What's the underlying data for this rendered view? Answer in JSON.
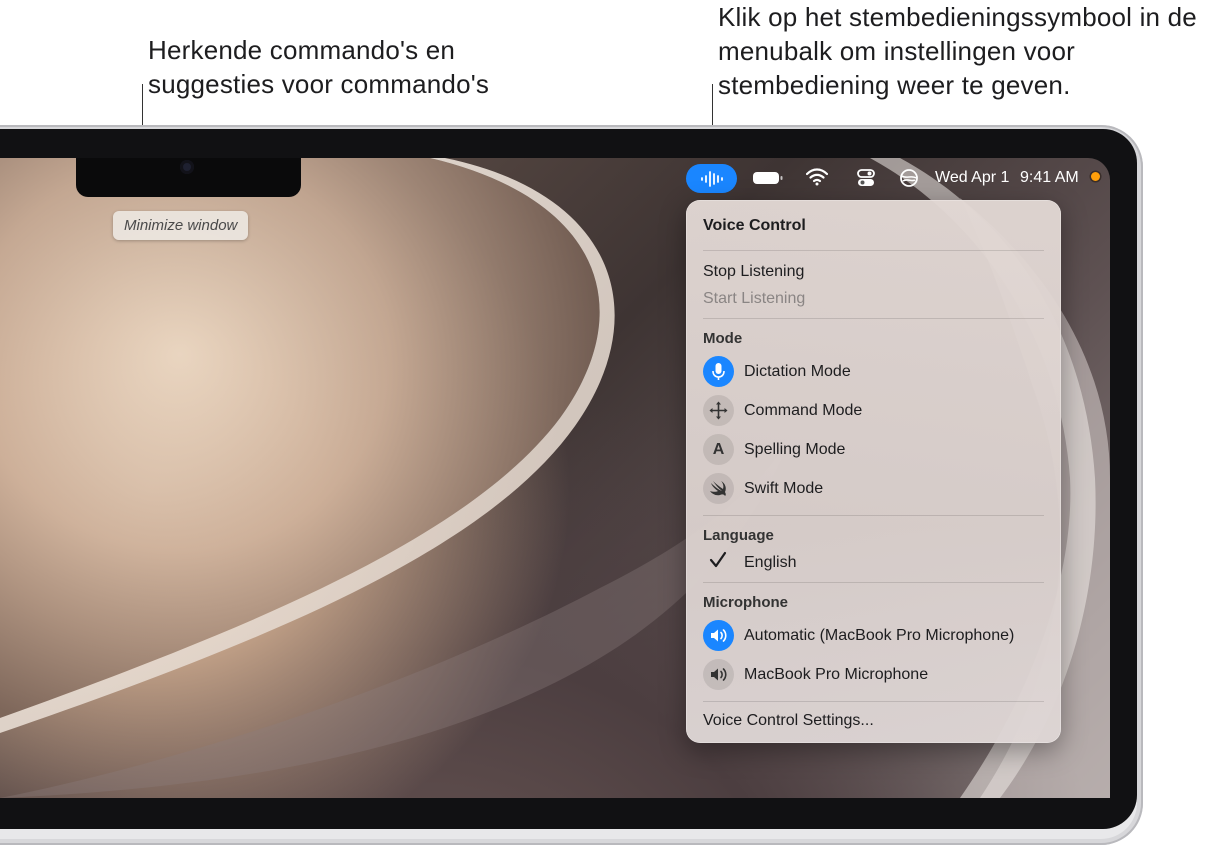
{
  "callouts": {
    "left": "Herkende commando's en suggesties voor commando's",
    "right": "Klik op het stembedieningssymbool in de menubalk om instellingen voor stembediening weer te geven."
  },
  "suggestion": {
    "text": "Minimize window"
  },
  "menubar": {
    "date": "Wed Apr 1",
    "time": "9:41 AM",
    "accent_color": "#1a86ff",
    "icons": [
      "voice-control-icon",
      "battery-icon",
      "wifi-icon",
      "control-center-icon",
      "vpn-icon"
    ]
  },
  "menu": {
    "title": "Voice Control",
    "stop_listening": "Stop Listening",
    "start_listening": "Start Listening",
    "mode_header": "Mode",
    "modes": [
      {
        "label": "Dictation Mode",
        "selected": true,
        "icon": "microphone-icon"
      },
      {
        "label": "Command Mode",
        "selected": false,
        "icon": "move-arrows-icon"
      },
      {
        "label": "Spelling Mode",
        "selected": false,
        "icon": "letter-a-icon",
        "glyph": "A"
      },
      {
        "label": "Swift Mode",
        "selected": false,
        "icon": "swift-icon"
      }
    ],
    "language_header": "Language",
    "language": {
      "label": "English",
      "checked": true
    },
    "microphone_header": "Microphone",
    "microphones": [
      {
        "label": "Automatic (MacBook Pro Microphone)",
        "selected": true,
        "icon": "speaker-icon"
      },
      {
        "label": "MacBook Pro Microphone",
        "selected": false,
        "icon": "speaker-icon"
      }
    ],
    "settings": "Voice Control Settings..."
  }
}
